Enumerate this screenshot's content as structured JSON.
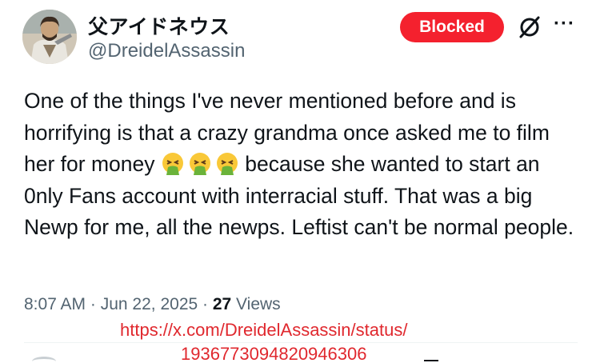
{
  "author": {
    "display_name": "父アイドネウス",
    "handle": "@DreidelAssassin",
    "avatar_icon": "avatar-illustration"
  },
  "actions": {
    "blocked_label": "Blocked",
    "grok_icon": "grok-icon",
    "more_icon": "more-options-icon",
    "accent_color": "#f4212e"
  },
  "tweet": {
    "text_before_emoji": "One of the things I've never mentioned before and is horrifying is that a crazy grandma once asked me to film her for money",
    "emoji": [
      "face-vomiting-emoji",
      "face-vomiting-emoji",
      "face-vomiting-emoji"
    ],
    "text_after_emoji": "because she wanted to start an 0nly Fans account with interracial stuff. That was a big Newp for me, all the newps. Leftist can't be normal people."
  },
  "meta": {
    "time": "8:07 AM",
    "separator": " · ",
    "date": "Jun 22, 2025",
    "views_count": "27",
    "views_label": "Views"
  },
  "source_url": {
    "line1": "https://x.com/DreidelAssassin/status/",
    "line2": "1936773094820946306"
  }
}
